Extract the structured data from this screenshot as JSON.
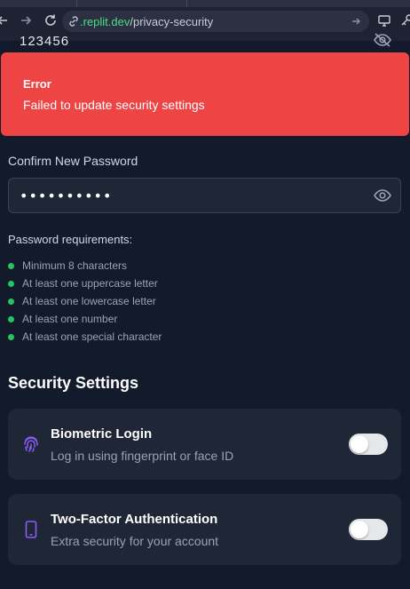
{
  "browser": {
    "url_host": ".replit.dev",
    "url_path": "/privacy-security"
  },
  "previous_field": {
    "value": "123456"
  },
  "error": {
    "title": "Error",
    "message": "Failed to update security settings"
  },
  "confirm_password": {
    "label": "Confirm New Password",
    "value": "••••••••••"
  },
  "requirements": {
    "title": "Password requirements:",
    "items": [
      "Minimum 8 characters",
      "At least one uppercase letter",
      "At least one lowercase letter",
      "At least one number",
      "At least one special character"
    ]
  },
  "security_settings": {
    "title": "Security Settings",
    "cards": [
      {
        "title": "Biometric Login",
        "subtitle": "Log in using fingerprint or face ID",
        "icon": "fingerprint-icon",
        "enabled": false
      },
      {
        "title": "Two-Factor Authentication",
        "subtitle": "Extra security for your account",
        "icon": "smartphone-icon",
        "enabled": false
      }
    ]
  },
  "colors": {
    "background": "#131a2b",
    "error": "#ef4444",
    "card": "#1f2636",
    "requirement_met": "#22c55e",
    "accent_icon": "#8b5cf6"
  }
}
